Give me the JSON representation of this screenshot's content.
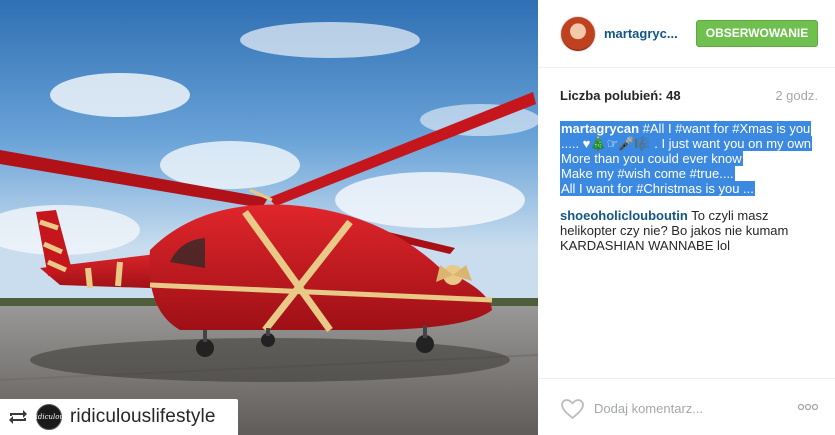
{
  "repost": {
    "username": "ridiculouslifestyle",
    "avatar_text": "Ridiculous",
    "icon": "repost-icon"
  },
  "post": {
    "author": "martagryc...",
    "follow_label": "OBSERWOWANIE",
    "likes_text": "Liczba polubień: 48",
    "time_text": "2 godz.",
    "caption": {
      "author": "martagrycan",
      "line1_rest": " #All I #want for #Xmas is you ",
      "line2": "..... ♥🎄☞🎤🎼 . I just want you on my own",
      "line3": "More than you could ever know",
      "line4": "Make my #wish come #true....",
      "line5": "All I want for #Christmas is you ..."
    },
    "comments": [
      {
        "user": "shoeoholiclouboutin",
        "text": " To czyli masz helikopter czy nie? Bo jakos nie kumam KARDASHIAN WANNABE lol"
      }
    ],
    "add_comment_placeholder": "Dodaj komentarz...",
    "icons": {
      "like": "heart-icon",
      "more": "more-options-icon"
    }
  },
  "colors": {
    "follow_green": "#70c050",
    "username_blue": "#125688",
    "selection_blue": "#3b89e0",
    "muted_gray": "#a5a7aa",
    "helicopter_red": "#c4161c",
    "ribbon_gold": "#e8c987"
  }
}
